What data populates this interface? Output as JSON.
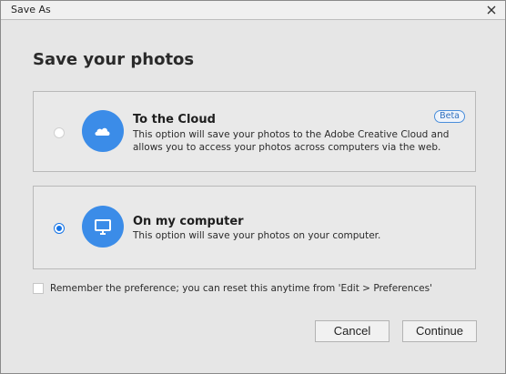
{
  "window": {
    "title": "Save As"
  },
  "heading": "Save your photos",
  "options": [
    {
      "title": "To the Cloud",
      "description": "This option will save your photos to the Adobe Creative Cloud and allows you to access your photos across computers via the web.",
      "badge": "Beta",
      "icon": "cloud-icon",
      "selected": false
    },
    {
      "title": "On my computer",
      "description": "This option will save your photos on your computer.",
      "icon": "monitor-icon",
      "selected": true
    }
  ],
  "remember": {
    "label": "Remember the preference; you can reset this anytime from 'Edit > Preferences'",
    "checked": false
  },
  "buttons": {
    "cancel": "Cancel",
    "continue": "Continue"
  },
  "colors": {
    "accent": "#3b8ce8",
    "radio_selected": "#1473e6",
    "background": "#e6e6e6"
  }
}
